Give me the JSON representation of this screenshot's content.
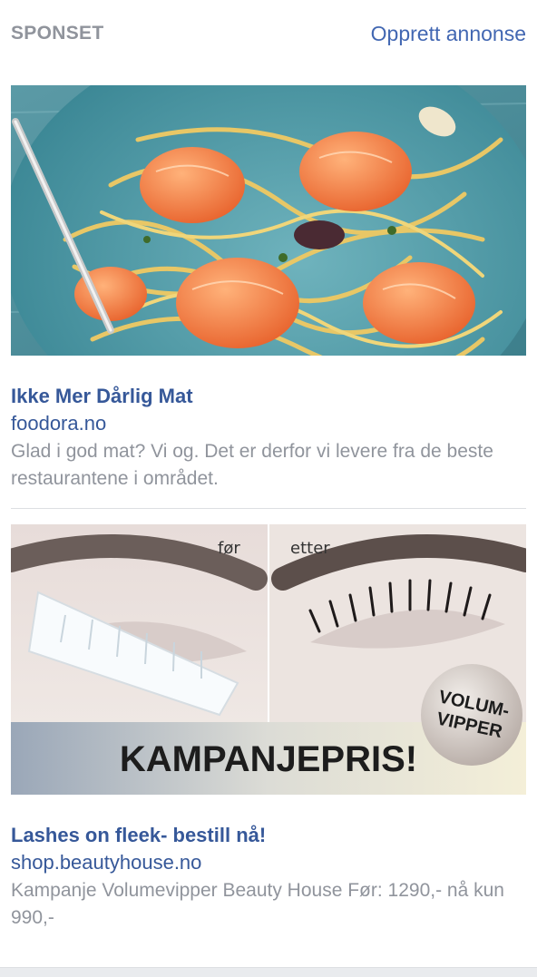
{
  "header": {
    "label": "SPONSET",
    "create_link": "Opprett annonse"
  },
  "ads": [
    {
      "title": "Ikke Mer Dårlig Mat",
      "domain": "foodora.no",
      "description": "Glad i god mat? Vi og. Det er derfor vi levere fra de beste restaurantene i området."
    },
    {
      "title": "Lashes on fleek- bestill nå!",
      "domain": "shop.beautyhouse.no",
      "description": "Kampanje Volumevipper Beauty House Før: 1290,- nå kun 990,-",
      "image_text": {
        "before": "før",
        "after": "etter",
        "badge_line1": "VOLUM-",
        "badge_line2": "VIPPER",
        "banner": "KAMPANJEPRIS!"
      }
    }
  ]
}
